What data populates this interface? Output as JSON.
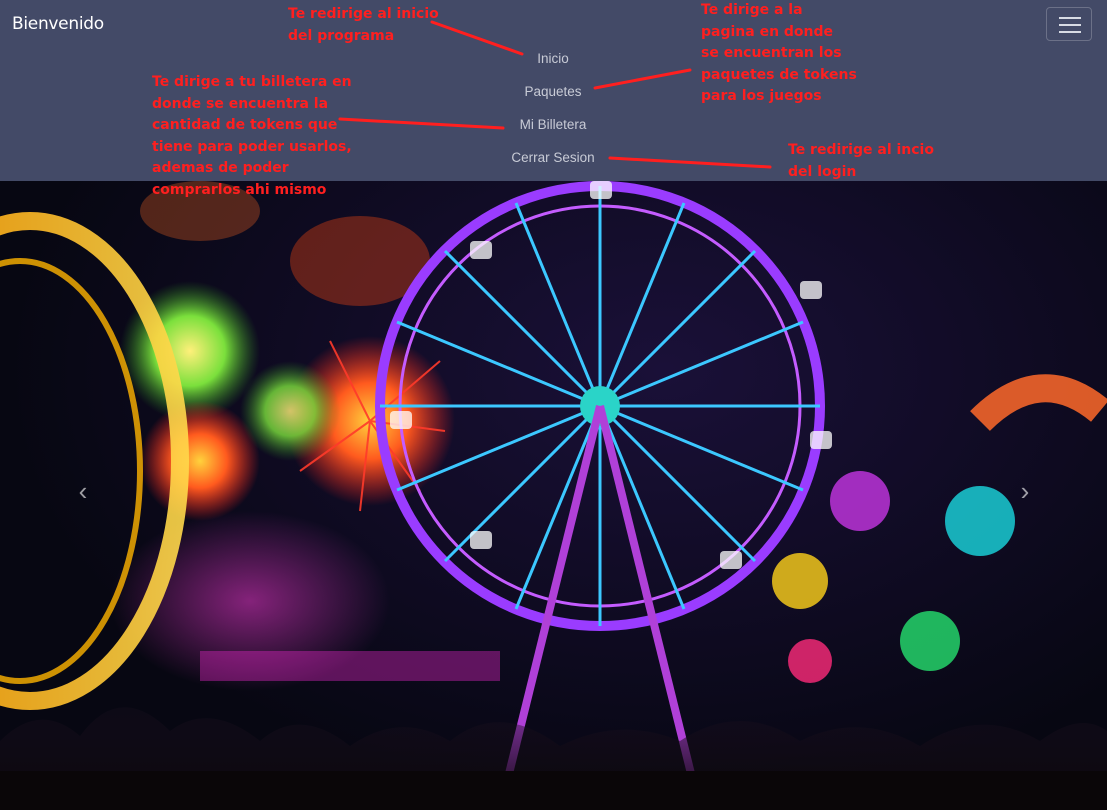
{
  "navbar": {
    "brand": "Bienvenido",
    "toggle_icon": "hamburger-icon",
    "links": [
      "Inicio",
      "Paquetes",
      "Mi Billetera",
      "Cerrar Sesion"
    ]
  },
  "annotations": {
    "inicio": "Te redirige al inicio\ndel programa",
    "paquetes": "Te dirige a la\npagina en donde\nse encuentran los\npaquetes de tokens\npara los juegos",
    "billetera": "Te dirige a tu billetera en\ndonde se encuentra la\ncantidad de tokens que\ntiene para poder usarlos,\nademas de poder\ncomprarlos ahi mismo",
    "cerrar": "Te redirige al incio\ndel login",
    "color": "#ff1f1f"
  },
  "carousel": {
    "prev_icon": "chevron-left-icon",
    "next_icon": "chevron-right-icon",
    "prev_glyph": "‹",
    "next_glyph": "›"
  },
  "colors": {
    "navbar_bg": "#434a67",
    "nav_link": "#c8cbd6"
  }
}
